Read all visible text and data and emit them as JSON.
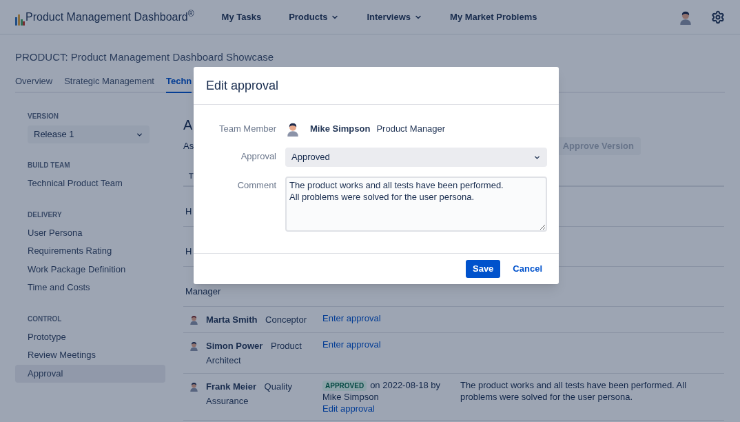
{
  "nav": {
    "logo": "Product Management Dashboard$^{®}$",
    "items": [
      {
        "label": "My Tasks",
        "dropdown": false
      },
      {
        "label": "Products",
        "dropdown": true
      },
      {
        "label": "Interviews",
        "dropdown": true
      },
      {
        "label": "My Market Problems",
        "dropdown": false
      }
    ]
  },
  "product_title": "PRODUCT: Product Management Dashboard Showcase",
  "tabs": [
    {
      "label": "Overview",
      "selected": false
    },
    {
      "label": "Strategic Management",
      "selected": false
    },
    {
      "label": "Techn",
      "selected": true
    }
  ],
  "sidebar": {
    "sections": [
      {
        "heading": "VERSION",
        "kind": "select",
        "value": "Release 1"
      },
      {
        "heading": "BUILD TEAM",
        "kind": "list",
        "items": [
          {
            "label": "Technical Product Team",
            "selected": false
          }
        ]
      },
      {
        "heading": "DELIVERY",
        "kind": "list",
        "items": [
          {
            "label": "User Persona",
            "selected": false
          },
          {
            "label": "Requirements Rating",
            "selected": false
          },
          {
            "label": "Work Package Definition",
            "selected": false
          },
          {
            "label": "Time and Costs",
            "selected": false
          }
        ]
      },
      {
        "heading": "CONTROL",
        "kind": "list",
        "items": [
          {
            "label": "Prototype",
            "selected": false
          },
          {
            "label": "Review Meetings",
            "selected": false
          },
          {
            "label": "Approval",
            "selected": true
          }
        ]
      }
    ]
  },
  "content": {
    "heading": "A",
    "subtitle": "As",
    "approve_button": {
      "label": "Approve Version",
      "disabled": true
    },
    "table": {
      "columns": [
        "T"
      ],
      "rows": [
        {
          "kind": "fragment",
          "text": "H"
        },
        {
          "kind": "fragment",
          "text": "H"
        },
        {
          "kind": "fragment",
          "text": "Manager"
        },
        {
          "kind": "member",
          "name": "Marta Smith",
          "role": "Conceptor",
          "action": "Enter approval"
        },
        {
          "kind": "member",
          "name": "Simon Power",
          "role": "Product Architect",
          "action": "Enter approval"
        },
        {
          "kind": "member",
          "name": "Frank Meier",
          "role": "Quality Assurance",
          "status": "APPROVED",
          "status_text": "on 2022-08-18 by Mike Simpson",
          "action": "Edit approval",
          "comment": "The product works and all tests have been performed. All problems were solved for the user persona."
        }
      ]
    }
  },
  "modal": {
    "title": "Edit approval",
    "fields": [
      {
        "kind": "member",
        "label": "Team Member",
        "name": "Mike Simpson",
        "role": "Product Manager"
      },
      {
        "kind": "select",
        "label": "Approval",
        "value": "Approved"
      },
      {
        "kind": "textarea",
        "label": "Comment",
        "value": "The product works and all tests have been performed.\nAll problems were solved for the user persona."
      }
    ],
    "buttons": [
      {
        "label": "Save",
        "kind": "primary"
      },
      {
        "label": "Cancel",
        "kind": "link"
      }
    ]
  }
}
